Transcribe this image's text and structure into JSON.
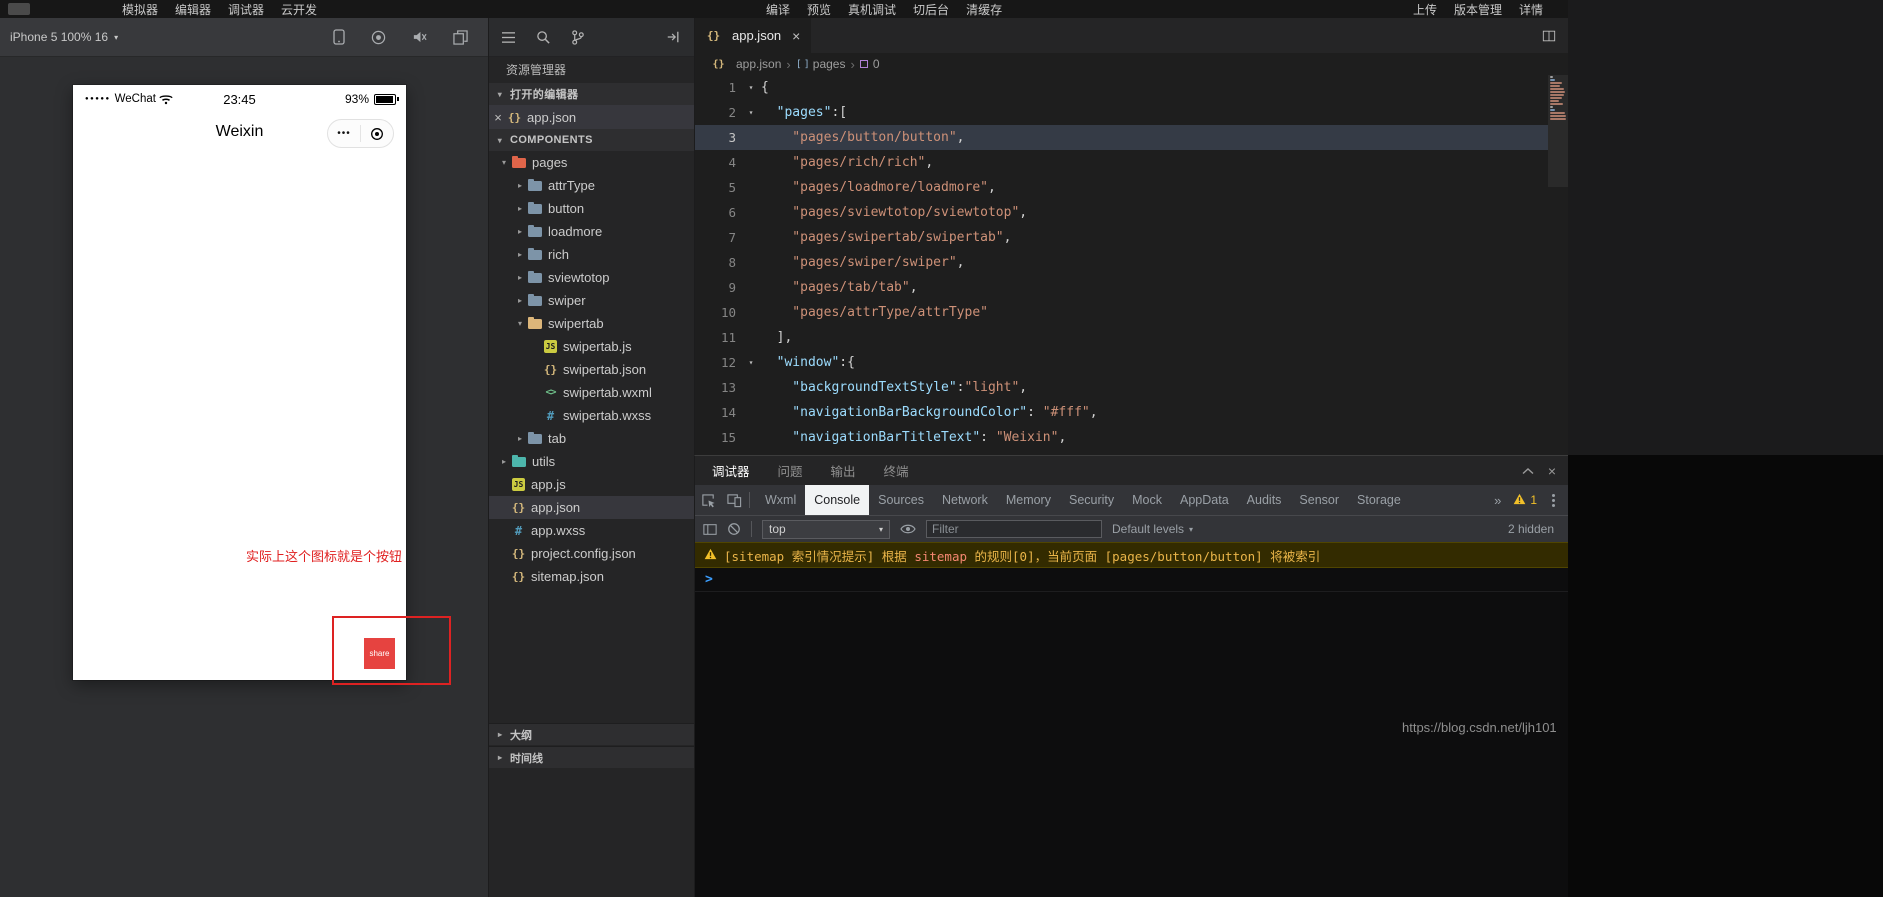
{
  "menubar": {
    "left": [
      "模拟器",
      "编辑器",
      "调试器",
      "云开发"
    ],
    "center": [
      "编译",
      "预览",
      "真机调试",
      "切后台",
      "清缓存"
    ],
    "right": [
      "上传",
      "版本管理",
      "详情"
    ]
  },
  "simulator": {
    "device_selector": "iPhone 5 100% 16",
    "status_bar": {
      "signal_dots": "●●●●●",
      "carrier": "WeChat",
      "time": "23:45",
      "battery_percent": "93%"
    },
    "nav_title": "Weixin",
    "capsule_more": "•••",
    "annotation_text": "实际上这个图标就是个按钮",
    "share_button_label": "share"
  },
  "explorer": {
    "panel_title": "资源管理器",
    "open_editors_label": "打开的编辑器",
    "project_label": "COMPONENTS",
    "outline_label": "大纲",
    "timeline_label": "时间线",
    "open_files": [
      {
        "name": "app.json",
        "type": "json"
      }
    ],
    "tree": [
      {
        "name": "pages",
        "type": "folder",
        "level": 0,
        "expanded": true,
        "color": "#e0654a"
      },
      {
        "name": "attrType",
        "type": "folder",
        "level": 1
      },
      {
        "name": "button",
        "type": "folder",
        "level": 1
      },
      {
        "name": "loadmore",
        "type": "folder",
        "level": 1
      },
      {
        "name": "rich",
        "type": "folder",
        "level": 1
      },
      {
        "name": "sviewtotop",
        "type": "folder",
        "level": 1
      },
      {
        "name": "swiper",
        "type": "folder",
        "level": 1
      },
      {
        "name": "swipertab",
        "type": "folder",
        "level": 1,
        "expanded": true,
        "color": "#dcb67a"
      },
      {
        "name": "swipertab.js",
        "type": "js",
        "level": 2
      },
      {
        "name": "swipertab.json",
        "type": "json",
        "level": 2
      },
      {
        "name": "swipertab.wxml",
        "type": "wxml",
        "level": 2
      },
      {
        "name": "swipertab.wxss",
        "type": "wxss",
        "level": 2
      },
      {
        "name": "tab",
        "type": "folder",
        "level": 1
      },
      {
        "name": "utils",
        "type": "folder",
        "level": 0,
        "color": "#4db6ac"
      },
      {
        "name": "app.js",
        "type": "js",
        "level": 0
      },
      {
        "name": "app.json",
        "type": "json",
        "level": 0,
        "selected": true
      },
      {
        "name": "app.wxss",
        "type": "wxss",
        "level": 0
      },
      {
        "name": "project.config.json",
        "type": "json",
        "level": 0
      },
      {
        "name": "sitemap.json",
        "type": "json",
        "level": 0
      }
    ]
  },
  "editor": {
    "tab_name": "app.json",
    "breadcrumb": [
      "app.json",
      "pages",
      "0"
    ],
    "active_line": 3,
    "lines": [
      {
        "n": 1,
        "fold": true,
        "tokens": [
          [
            "p",
            "{"
          ]
        ]
      },
      {
        "n": 2,
        "fold": true,
        "tokens": [
          [
            "k",
            "  \"pages\""
          ],
          [
            "p",
            ":["
          ]
        ]
      },
      {
        "n": 3,
        "tokens": [
          [
            "s",
            "    \"pages/button/button\""
          ],
          [
            "p",
            ","
          ]
        ]
      },
      {
        "n": 4,
        "tokens": [
          [
            "s",
            "    \"pages/rich/rich\""
          ],
          [
            "p",
            ","
          ]
        ]
      },
      {
        "n": 5,
        "tokens": [
          [
            "s",
            "    \"pages/loadmore/loadmore\""
          ],
          [
            "p",
            ","
          ]
        ]
      },
      {
        "n": 6,
        "tokens": [
          [
            "s",
            "    \"pages/sviewtotop/sviewtotop\""
          ],
          [
            "p",
            ","
          ]
        ]
      },
      {
        "n": 7,
        "tokens": [
          [
            "s",
            "    \"pages/swipertab/swipertab\""
          ],
          [
            "p",
            ","
          ]
        ]
      },
      {
        "n": 8,
        "tokens": [
          [
            "s",
            "    \"pages/swiper/swiper\""
          ],
          [
            "p",
            ","
          ]
        ]
      },
      {
        "n": 9,
        "tokens": [
          [
            "s",
            "    \"pages/tab/tab\""
          ],
          [
            "p",
            ","
          ]
        ]
      },
      {
        "n": 10,
        "tokens": [
          [
            "s",
            "    \"pages/attrType/attrType\""
          ]
        ]
      },
      {
        "n": 11,
        "tokens": [
          [
            "p",
            "  ],"
          ]
        ]
      },
      {
        "n": 12,
        "fold": true,
        "tokens": [
          [
            "k",
            "  \"window\""
          ],
          [
            "p",
            ":{"
          ]
        ]
      },
      {
        "n": 13,
        "tokens": [
          [
            "k",
            "    \"backgroundTextStyle\""
          ],
          [
            "p",
            ":"
          ],
          [
            "s",
            "\"light\""
          ],
          [
            "p",
            ","
          ]
        ]
      },
      {
        "n": 14,
        "tokens": [
          [
            "k",
            "    \"navigationBarBackgroundColor\""
          ],
          [
            "p",
            ": "
          ],
          [
            "s",
            "\"#fff\""
          ],
          [
            "p",
            ","
          ]
        ]
      },
      {
        "n": 15,
        "tokens": [
          [
            "k",
            "    \"navigationBarTitleText\""
          ],
          [
            "p",
            ": "
          ],
          [
            "s",
            "\"Weixin\""
          ],
          [
            "p",
            ","
          ]
        ]
      }
    ]
  },
  "debugger_panel": {
    "tabs": [
      "调试器",
      "问题",
      "输出",
      "终端"
    ],
    "active_tab": "调试器",
    "devtools_tabs": [
      "Wxml",
      "Console",
      "Sources",
      "Network",
      "Memory",
      "Security",
      "Mock",
      "AppData",
      "Audits",
      "Sensor",
      "Storage"
    ],
    "active_devtools_tab": "Console",
    "more_tabs_symbol": "»",
    "warning_count": "1",
    "console_toolbar": {
      "context": "top",
      "filter_placeholder": "Filter",
      "levels": "Default levels",
      "hidden_count": "2 hidden"
    },
    "warning_message": [
      {
        "type": "text",
        "text": "[sitemap 索引情况提示] 根据 "
      },
      {
        "type": "code",
        "text": "sitemap"
      },
      {
        "type": "text",
        "text": " 的规则[0]，当前页面 [pages/button/button] 将被索引"
      }
    ],
    "prompt_symbol": ">"
  },
  "watermark": "https://blog.csdn.net/ljh101",
  "colors": {
    "share_button_red": "#e64340",
    "annotation_red": "#dd2222",
    "warning_yellow": "#eab549",
    "json_key_blue": "#9cdcfe",
    "json_string_orange": "#ce9178"
  }
}
